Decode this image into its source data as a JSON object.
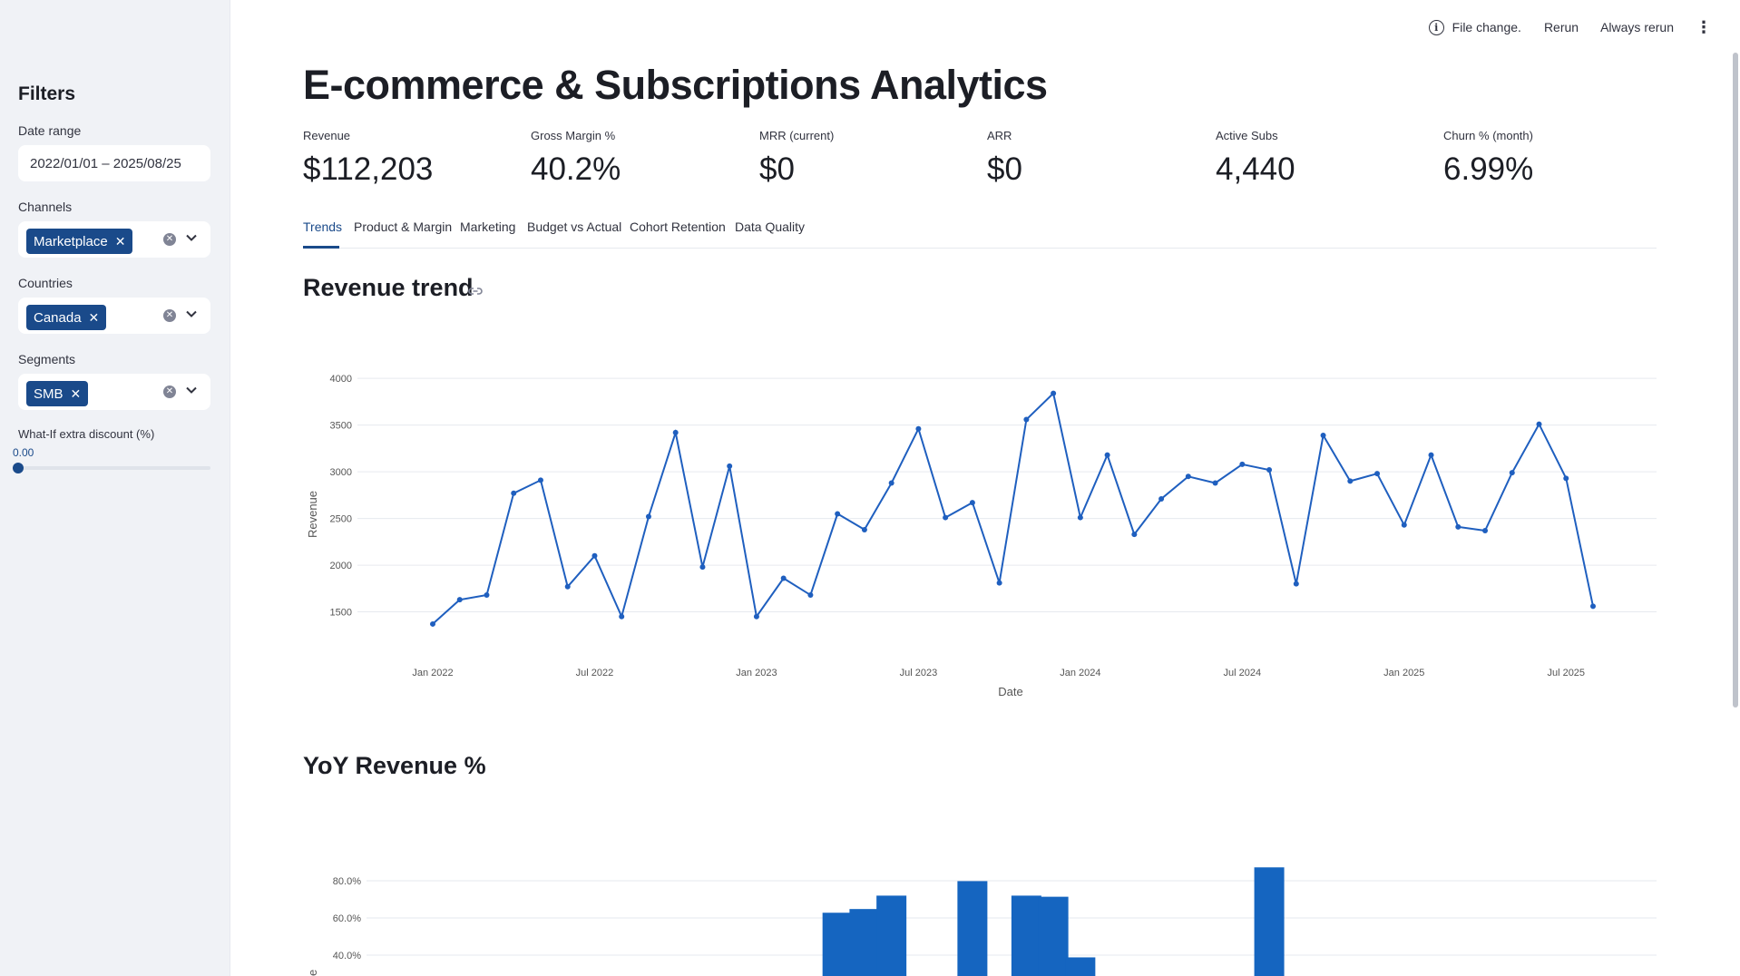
{
  "sidebar": {
    "title": "Filters",
    "date_range": {
      "label": "Date range",
      "value": "2022/01/01 – 2025/08/25"
    },
    "channels": {
      "label": "Channels",
      "chips": [
        "Marketplace"
      ]
    },
    "countries": {
      "label": "Countries",
      "chips": [
        "Canada"
      ]
    },
    "segments": {
      "label": "Segments",
      "chips": [
        "SMB"
      ]
    },
    "discount": {
      "label": "What-If extra discount (%)",
      "value": "0.00",
      "fraction": 0
    }
  },
  "topbar": {
    "status": "File change.",
    "rerun": "Rerun",
    "always_rerun": "Always rerun"
  },
  "title": "E-commerce & Subscriptions Analytics",
  "metrics": [
    {
      "label": "Revenue",
      "value": "$112,203"
    },
    {
      "label": "Gross Margin %",
      "value": "40.2%"
    },
    {
      "label": "MRR (current)",
      "value": "$0"
    },
    {
      "label": "ARR",
      "value": "$0"
    },
    {
      "label": "Active Subs",
      "value": "4,440"
    },
    {
      "label": "Churn % (month)",
      "value": "6.99%"
    }
  ],
  "tabs": [
    "Trends",
    "Product & Margin",
    "Marketing",
    "Budget vs Actual",
    "Cohort Retention",
    "Data Quality"
  ],
  "active_tab": "Trends",
  "sections": {
    "revenue_trend": "Revenue trend",
    "yoy": "YoY Revenue %"
  },
  "colors": {
    "accent": "#1a4a8a",
    "series": "#1f5fbf",
    "bar": "#1565c0"
  },
  "chart_data": [
    {
      "type": "line",
      "title": "Revenue trend",
      "xlabel": "Date",
      "ylabel": "Revenue",
      "x_ticks": [
        "Jan 2022",
        "Jul 2022",
        "Jan 2023",
        "Jul 2023",
        "Jan 2024",
        "Jul 2024",
        "Jan 2025",
        "Jul 2025"
      ],
      "y_ticks": [
        1500,
        2000,
        2500,
        3000,
        3500,
        4000
      ],
      "ylim": [
        1350,
        4050
      ],
      "x": [
        "2022-01",
        "2022-02",
        "2022-03",
        "2022-04",
        "2022-05",
        "2022-06",
        "2022-07",
        "2022-08",
        "2022-09",
        "2022-10",
        "2022-11",
        "2022-12",
        "2023-01",
        "2023-02",
        "2023-03",
        "2023-04",
        "2023-05",
        "2023-06",
        "2023-07",
        "2023-08",
        "2023-09",
        "2023-10",
        "2023-11",
        "2023-12",
        "2024-01",
        "2024-02",
        "2024-03",
        "2024-04",
        "2024-05",
        "2024-06",
        "2024-07",
        "2024-08",
        "2024-09",
        "2024-10",
        "2024-11",
        "2024-12",
        "2025-01",
        "2025-02",
        "2025-03",
        "2025-04",
        "2025-05",
        "2025-06",
        "2025-07",
        "2025-08"
      ],
      "values": [
        1370,
        1630,
        1680,
        2770,
        2910,
        1770,
        2100,
        1450,
        2520,
        3420,
        1980,
        3060,
        1450,
        1860,
        1680,
        2550,
        2380,
        2880,
        3460,
        2510,
        2670,
        1810,
        3560,
        3840,
        2510,
        3180,
        2330,
        2710,
        2950,
        2880,
        3080,
        3020,
        1800,
        3390,
        2900,
        2980,
        2430,
        3180,
        2410,
        2370,
        2990,
        3510,
        2930,
        1560
      ]
    },
    {
      "type": "bar",
      "title": "YoY Revenue %",
      "y_ticks": [
        "40.0%",
        "60.0%",
        "80.0%"
      ],
      "ylim": [
        20,
        95
      ],
      "x": [
        "2023-04",
        "2023-05",
        "2023-06",
        "2023-09",
        "2023-11",
        "2023-12",
        "2024-01",
        "2024-08"
      ],
      "values": [
        62.8,
        64.8,
        72.0,
        79.8,
        72.0,
        71.4,
        38.8,
        87.2
      ]
    }
  ]
}
